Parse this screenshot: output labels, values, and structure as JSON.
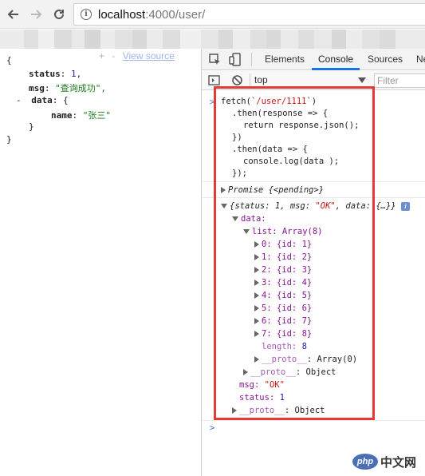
{
  "browser": {
    "url_host": "localhost",
    "url_path": ":4000/user/",
    "info_glyph": "i"
  },
  "page": {
    "lines": [
      "{",
      "status",
      "1,",
      "msg",
      "\"查询成功\",",
      "-",
      "data",
      "{",
      "name",
      "\"张三\"",
      "}",
      "}"
    ],
    "toolbar_plus": "+",
    "toolbar_minus": "-",
    "view_source": "View source"
  },
  "devtools": {
    "tabs": [
      "Elements",
      "Console",
      "Sources",
      "Ne"
    ],
    "active_tab": "Console",
    "context": "top",
    "filter_placeholder": "Filter",
    "console": {
      "code_line1_a": "fetch(`",
      "code_line1_b": "/user/1111",
      "code_line1_c": "`)",
      "code_line2": ".then(response => {",
      "code_line3": "return response.json();",
      "code_line4": "})",
      "code_line5": ".then(data => {",
      "code_line6": "console.log(data );",
      "code_line7": "});",
      "promise": "Promise {<pending>}",
      "obj_summary_a": "{status: 1, msg: ",
      "obj_summary_b": "\"OK\"",
      "obj_summary_c": ", data: {…}}",
      "data_label": "data:",
      "list_label": "list: Array(8)",
      "items": [
        "0: {id: 1}",
        "1: {id: 2}",
        "2: {id: 3}",
        "3: {id: 4}",
        "4: {id: 5}",
        "5: {id: 6}",
        "6: {id: 7}",
        "7: {id: 8}"
      ],
      "length_key": "length:",
      "length_val": "8",
      "proto_key": "__proto__",
      "proto_array": ": Array(0)",
      "proto_object": ": Object",
      "msg_key": "msg:",
      "msg_val": "\"OK\"",
      "status_key": "status:",
      "status_val": "1",
      "prompt": ">"
    }
  },
  "watermark": {
    "logo": "php",
    "text": "中文网"
  },
  "colors": {
    "highlight": "#e53935",
    "accent": "#1a73e8",
    "console_purple": "#881391"
  }
}
